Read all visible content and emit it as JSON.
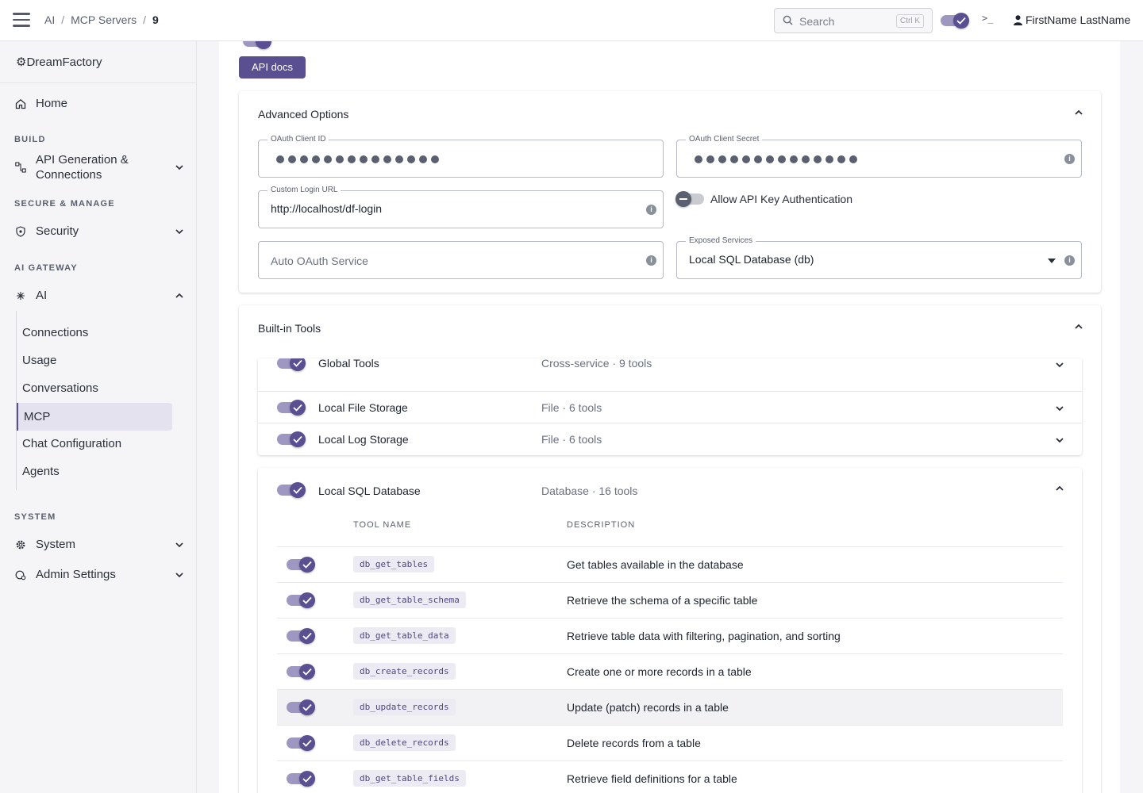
{
  "topbar": {
    "breadcrumbs": [
      "AI",
      "MCP Servers",
      "9"
    ],
    "search_placeholder": "Search",
    "search_shortcut": "Ctrl K",
    "terminal_glyph": ">_",
    "user_name": "FirstName LastName"
  },
  "sidebar": {
    "brand": "DreamFactory",
    "home": "Home",
    "sections": {
      "build": "BUILD",
      "secure": "SECURE & MANAGE",
      "ai_gateway": "AI GATEWAY",
      "system": "SYSTEM"
    },
    "api_generation": "API Generation & Connections",
    "security": "Security",
    "ai": "AI",
    "ai_items": [
      "Connections",
      "Usage",
      "Conversations",
      "MCP",
      "Chat Configuration",
      "Agents"
    ],
    "active_ai_item": "MCP",
    "system": "System",
    "admin_settings": "Admin Settings"
  },
  "main": {
    "api_docs_label": "API docs",
    "advanced": {
      "title": "Advanced Options",
      "oauth_client_id_label": "OAuth Client ID",
      "oauth_client_secret_label": "OAuth Client Secret",
      "custom_login_url_label": "Custom Login URL",
      "custom_login_url_value": "http://localhost/df-login",
      "allow_api_key_label": "Allow API Key Authentication",
      "allow_api_key_enabled": false,
      "auto_oauth_placeholder": "Auto OAuth Service",
      "exposed_services_label": "Exposed Services",
      "exposed_services_value": "Local SQL Database (db)"
    },
    "builtin": {
      "title": "Built-in Tools",
      "services": [
        {
          "name": "Global Tools",
          "meta": "Cross-service · 9 tools"
        },
        {
          "name": "Local File Storage",
          "meta": "File · 6 tools"
        },
        {
          "name": "Local Log Storage",
          "meta": "File · 6 tools"
        }
      ],
      "expanded": {
        "name": "Local SQL Database",
        "meta": "Database · 16 tools",
        "col_tool": "TOOL NAME",
        "col_desc": "DESCRIPTION",
        "tools": [
          {
            "name": "db_get_tables",
            "desc": "Get tables available in the database"
          },
          {
            "name": "db_get_table_schema",
            "desc": "Retrieve the schema of a specific table"
          },
          {
            "name": "db_get_table_data",
            "desc": "Retrieve table data with filtering, pagination, and sorting"
          },
          {
            "name": "db_create_records",
            "desc": "Create one or more records in a table"
          },
          {
            "name": "db_update_records",
            "desc": "Update (patch) records in a table"
          },
          {
            "name": "db_delete_records",
            "desc": "Delete records from a table"
          },
          {
            "name": "db_get_table_fields",
            "desc": "Retrieve field definitions for a table"
          }
        ]
      }
    }
  },
  "colors": {
    "accent": "#5a4f91",
    "accent_light": "#9e97c2",
    "active_bg": "#e5e2ef"
  }
}
